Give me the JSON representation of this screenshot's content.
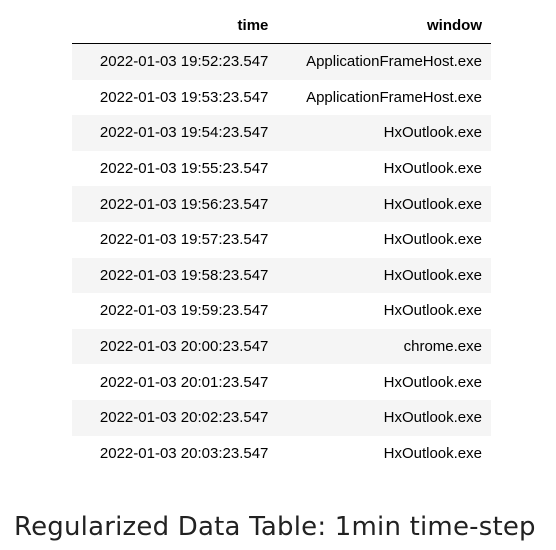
{
  "table": {
    "columns": [
      "time",
      "window"
    ],
    "rows": [
      [
        "2022-01-03 19:52:23.547",
        "ApplicationFrameHost.exe"
      ],
      [
        "2022-01-03 19:53:23.547",
        "ApplicationFrameHost.exe"
      ],
      [
        "2022-01-03 19:54:23.547",
        "HxOutlook.exe"
      ],
      [
        "2022-01-03 19:55:23.547",
        "HxOutlook.exe"
      ],
      [
        "2022-01-03 19:56:23.547",
        "HxOutlook.exe"
      ],
      [
        "2022-01-03 19:57:23.547",
        "HxOutlook.exe"
      ],
      [
        "2022-01-03 19:58:23.547",
        "HxOutlook.exe"
      ],
      [
        "2022-01-03 19:59:23.547",
        "HxOutlook.exe"
      ],
      [
        "2022-01-03 20:00:23.547",
        "chrome.exe"
      ],
      [
        "2022-01-03 20:01:23.547",
        "HxOutlook.exe"
      ],
      [
        "2022-01-03 20:02:23.547",
        "HxOutlook.exe"
      ],
      [
        "2022-01-03 20:03:23.547",
        "HxOutlook.exe"
      ]
    ]
  },
  "caption": "Regularized Data Table: 1min time-step"
}
